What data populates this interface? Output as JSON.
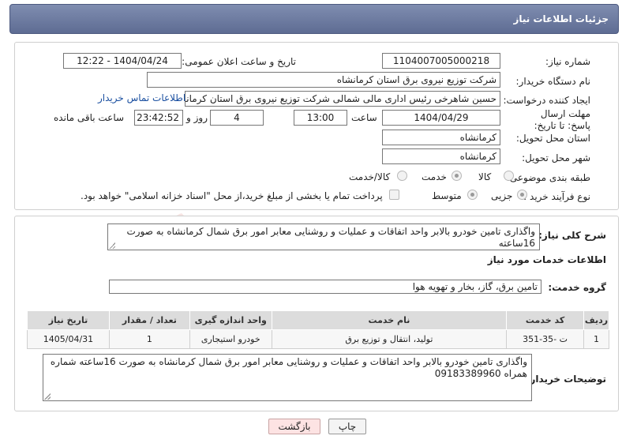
{
  "header": {
    "title": "جزئیات اطلاعات نیاز"
  },
  "form": {
    "need_number_label": "شماره نیاز:",
    "need_number": "1104007005000218",
    "announce_label": "تاریخ و ساعت اعلان عمومی:",
    "announce_value": "1404/04/24 - 12:22",
    "buyer_org_label": "نام دستگاه خریدار:",
    "buyer_org": "شرکت توزیع نیروی برق استان کرمانشاه",
    "creator_label": "ایجاد کننده درخواست:",
    "creator": "حسین شاهرخی رئیس اداری مالی شمالی شرکت توزیع نیروی برق استان کرمانشاه",
    "contact_link": "اطلاعات تماس خریدار",
    "deadline_label": "مهلت ارسال پاسخ: تا تاریخ:",
    "deadline_date": "1404/04/29",
    "time_label": "ساعت",
    "deadline_time": "13:00",
    "days": "4",
    "days_label": "روز و",
    "remaining_time": "23:42:52",
    "remaining_label": "ساعت باقی مانده",
    "province_label": "استان محل تحویل:",
    "province": "کرمانشاه",
    "city_label": "شهر محل تحویل:",
    "city": "کرمانشاه",
    "category_label": "طبقه بندی موضوعی:",
    "category_options": [
      "کالا",
      "خدمت",
      "کالا/خدمت"
    ],
    "category_selected": "خدمت",
    "process_label": "نوع فرآیند خرید :",
    "process_options": [
      "جزیی",
      "متوسط"
    ],
    "process_selected": "جزیی",
    "payment_note": "پرداخت تمام یا بخشی از مبلغ خرید،از محل \"اسناد خزانه اسلامی\" خواهد بود."
  },
  "details": {
    "summary_label": "شرح کلی نیاز:",
    "summary": "واگذاری تامین خودرو  بالابر واحد اتفاقات و عملیات و روشنایی معابر امور برق شمال کرمانشاه  به صورت 16ساعته",
    "services_title": "اطلاعات خدمات مورد نیاز",
    "service_group_label": "گروه خدمت:",
    "service_group": "تامین برق، گاز، بخار و تهویه هوا",
    "table": {
      "headers": [
        "ردیف",
        "کد خدمت",
        "نام خدمت",
        "واحد اندازه گیری",
        "تعداد / مقدار",
        "تاریخ نیاز"
      ],
      "rows": [
        [
          "1",
          "ت -35-351",
          "تولید، انتقال و توزیع برق",
          "خودرو استیجاری",
          "1",
          "1405/04/31"
        ]
      ]
    },
    "buyer_notes_label": "توضیحات خریدار:",
    "buyer_notes": "واگذاری تامین خودرو  بالابر واحد اتفاقات و عملیات و روشنایی معابر امور برق شمال کرمانشاه  به صورت 16ساعته  شماره همراه 09183389960"
  },
  "buttons": {
    "print": "چاپ",
    "back": "بازگشت"
  },
  "watermark_text": "AriaTender.neT",
  "colors": {
    "header_bg": "#6b7aa1",
    "link": "#1a4fa0",
    "back_btn": "#fde3e3"
  }
}
